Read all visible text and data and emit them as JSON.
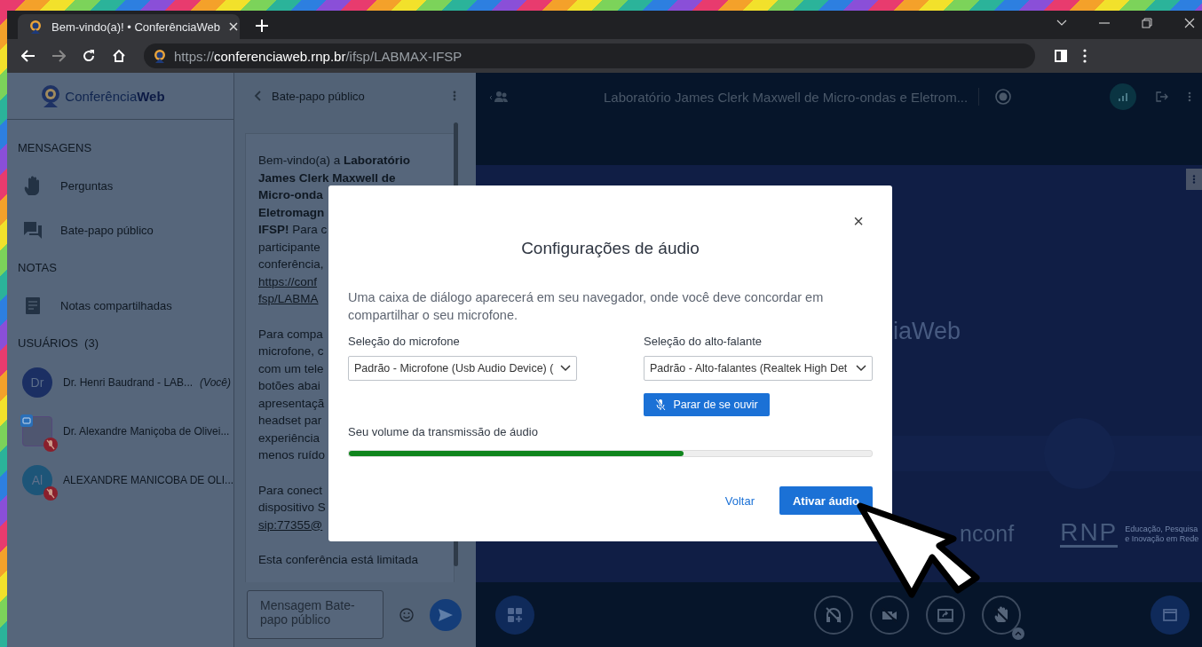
{
  "browser": {
    "tab_title": "Bem-vindo(a)! • ConferênciaWeb",
    "url": {
      "scheme": "https://",
      "host": "conferenciaweb.rnp.br",
      "path": "/ifsp/LABMAX-IFSP"
    }
  },
  "sidebar": {
    "logo": "Conferência**Web**",
    "sections": [
      {
        "title": "MENSAGENS",
        "items": [
          {
            "kind": "hand",
            "label": "Perguntas"
          },
          {
            "kind": "chat",
            "label": "Bate-papo público"
          }
        ]
      },
      {
        "title": "NOTAS",
        "items": [
          {
            "kind": "note",
            "label": "Notas compartilhadas"
          }
        ]
      }
    ],
    "users_title": "USUÁRIOS  (3)",
    "users": [
      {
        "kind": "initials",
        "initials": "Dr",
        "color": "#1b2f63",
        "name": "Dr. Henri Baudrand - LAB...",
        "tag": "(Você)",
        "presenter": false,
        "muted": false
      },
      {
        "kind": "photo",
        "name": "Dr. Alexandre Maniçoba de Olivei...",
        "presenter": true,
        "muted": true
      },
      {
        "kind": "initials",
        "initials": "Al",
        "color": "#1d5578",
        "name": "ALEXANDRE MANICOBA DE OLI...",
        "presenter": false,
        "muted": true
      }
    ]
  },
  "chat": {
    "title": "Bate-papo público",
    "paragraphs": [
      [
        {
          "kind": "text",
          "text": "Bem-vindo(a) a **Laboratório**"
        },
        {
          "kind": "text",
          "text": "**James Clerk Maxwell de**"
        },
        {
          "kind": "text",
          "text": "**Micro-onda**"
        },
        {
          "kind": "text",
          "text": "**Eletromagn**"
        },
        {
          "kind": "text",
          "text": "**IFSP!** Para c"
        },
        {
          "kind": "text",
          "text": "participante"
        },
        {
          "kind": "text",
          "text": "conferência,"
        },
        {
          "kind": "link",
          "text": "https://conf"
        },
        {
          "kind": "link",
          "text": "fsp/LABMA"
        }
      ],
      [
        {
          "kind": "text",
          "text": "Para compa"
        },
        {
          "kind": "text",
          "text": "microfone, c"
        },
        {
          "kind": "text",
          "text": "com um tele"
        },
        {
          "kind": "text",
          "text": "botões abai"
        },
        {
          "kind": "text",
          "text": "apresentaçã"
        },
        {
          "kind": "text",
          "text": "headset par"
        },
        {
          "kind": "text",
          "text": "experiência"
        },
        {
          "kind": "text",
          "text": "menos ruído"
        }
      ],
      [
        {
          "kind": "text",
          "text": "Para conect"
        },
        {
          "kind": "text",
          "text": "dispositivo S"
        },
        {
          "kind": "link",
          "text": "sip:77355@"
        }
      ],
      [
        {
          "kind": "text",
          "text": "Esta conferência está limitada"
        }
      ]
    ],
    "input": {
      "placeholder": "Mensagem Bate-papo público"
    }
  },
  "meeting": {
    "title": "Laboratório James Clerk Maxwell de Micro-ondas e Eletrom...",
    "slide": {
      "logo_fragment": "iaWeb",
      "partner_fragment": "nconf",
      "rnp_logo": "RNP",
      "tagline": [
        "Educação, Pesquisa",
        "e Inovação em Rede"
      ]
    }
  },
  "dialog": {
    "title": "Configurações de áudio",
    "close": "×",
    "description": "Uma caixa de diálogo aparecerá em seu navegador, onde você deve concordar em compartilhar o seu microfone.",
    "microphone": {
      "label": "Seleção do microfone",
      "value": "Padrão - Microfone (Usb Audio Device) ("
    },
    "speaker": {
      "label": "Seleção do alto-falante",
      "value": "Padrão - Alto-falantes (Realtek High Det"
    },
    "monitor_button": "Parar de se ouvir",
    "volume": {
      "label": "Seu volume da transmissão de áudio",
      "level": 0.64
    },
    "back": "Voltar",
    "confirm": "Ativar áudio"
  }
}
